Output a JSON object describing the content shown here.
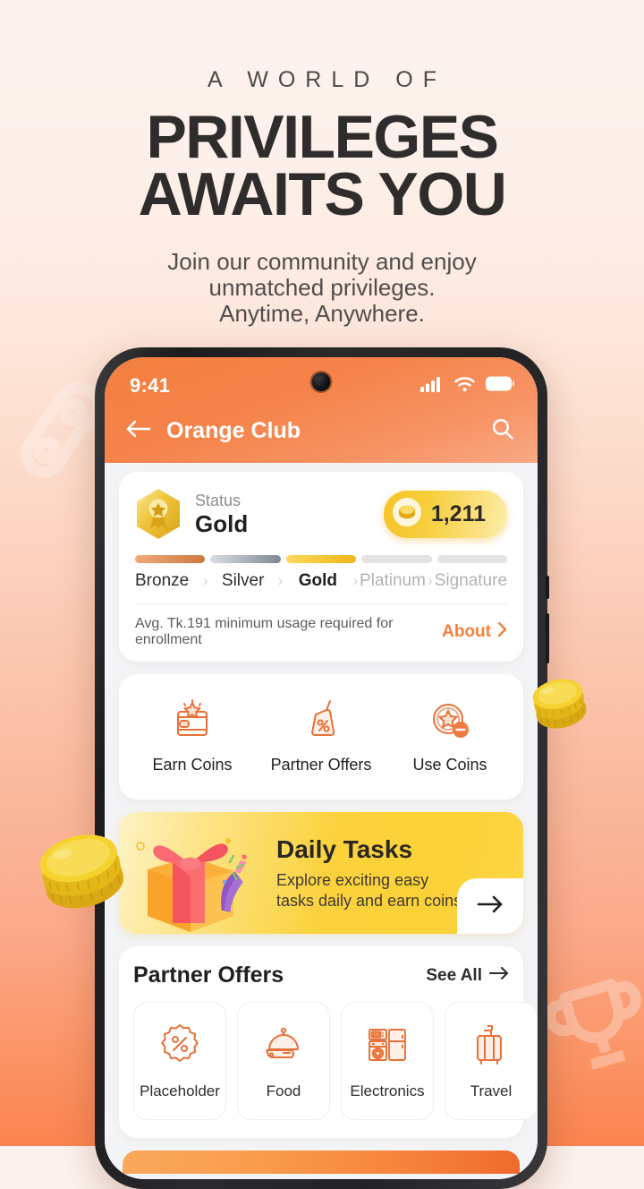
{
  "hero": {
    "eyebrow": "A WORLD OF",
    "title_line1": "PRIVILEGES",
    "title_line2": "AWAITS YOU",
    "subtitle_line1": "Join our community and enjoy",
    "subtitle_line2": "unmatched privileges.",
    "subtitle_line3": "Anytime, Anywhere."
  },
  "colors": {
    "brand_orange": "#f4803f",
    "gold": "#fbd137",
    "page_bg_top": "#fdf1ec",
    "page_bg_bottom": "#fb8450",
    "text_dark": "#1f1f21",
    "text_muted": "#8e8e93"
  },
  "phone": {
    "status_bar": {
      "time": "9:41",
      "icons": [
        "cellular-signal-icon",
        "wifi-icon",
        "battery-icon"
      ]
    },
    "nav": {
      "back_icon": "arrow-left-icon",
      "title": "Orange Club",
      "search_icon": "search-icon"
    }
  },
  "status_card": {
    "badge_icon": "hexagon-medal-icon",
    "status_label": "Status",
    "tier_value": "Gold",
    "coin_icon": "coin-icon",
    "coin_balance": "1,211",
    "tiers": [
      {
        "label": "Bronze",
        "state": "done",
        "bar_color_start": "#f0a97a",
        "bar_color_end": "#cd7b3d"
      },
      {
        "label": "Silver",
        "state": "done",
        "bar_color_start": "#d8dde2",
        "bar_color_end": "#7e8893"
      },
      {
        "label": "Gold",
        "state": "active",
        "bar_color_start": "#fcd85e",
        "bar_color_end": "#f0b519"
      },
      {
        "label": "Platinum",
        "state": "future",
        "bar_color_start": "#e3e3e5",
        "bar_color_end": "#e3e3e5"
      },
      {
        "label": "Signature",
        "state": "future",
        "bar_color_start": "#e3e3e5",
        "bar_color_end": "#e3e3e5"
      }
    ],
    "tier_separator": "›",
    "footer_note": "Avg. Tk.191 minimum usage required for enrollment",
    "about_label": "About",
    "about_chevron_icon": "chevron-right-icon"
  },
  "quick_actions": [
    {
      "label": "Earn Coins",
      "icon": "wallet-star-icon"
    },
    {
      "label": "Partner Offers",
      "icon": "percent-tag-icon"
    },
    {
      "label": "Use Coins",
      "icon": "star-coin-minus-icon"
    }
  ],
  "daily_tasks": {
    "illustration_icon": "gift-box-icon",
    "title": "Daily Tasks",
    "subtitle_line1": "Explore exciting easy",
    "subtitle_line2": "tasks daily and earn coins!",
    "arrow_icon": "arrow-right-icon"
  },
  "partner_offers": {
    "title": "Partner Offers",
    "see_all_label": "See All",
    "see_all_icon": "arrow-right-icon",
    "tiles": [
      {
        "label": "Placeholder",
        "icon": "percent-badge-icon"
      },
      {
        "label": "Food",
        "icon": "food-cloche-icon"
      },
      {
        "label": "Electronics",
        "icon": "appliances-icon"
      },
      {
        "label": "Travel",
        "icon": "luggage-icon"
      }
    ]
  },
  "decorations": {
    "watermark_left_icon": "tag-watermark-icon",
    "watermark_right_icon": "trophy-watermark-icon",
    "coin_left_icon": "coin-stack-icon",
    "coin_right_icon": "coin-stack-icon"
  }
}
